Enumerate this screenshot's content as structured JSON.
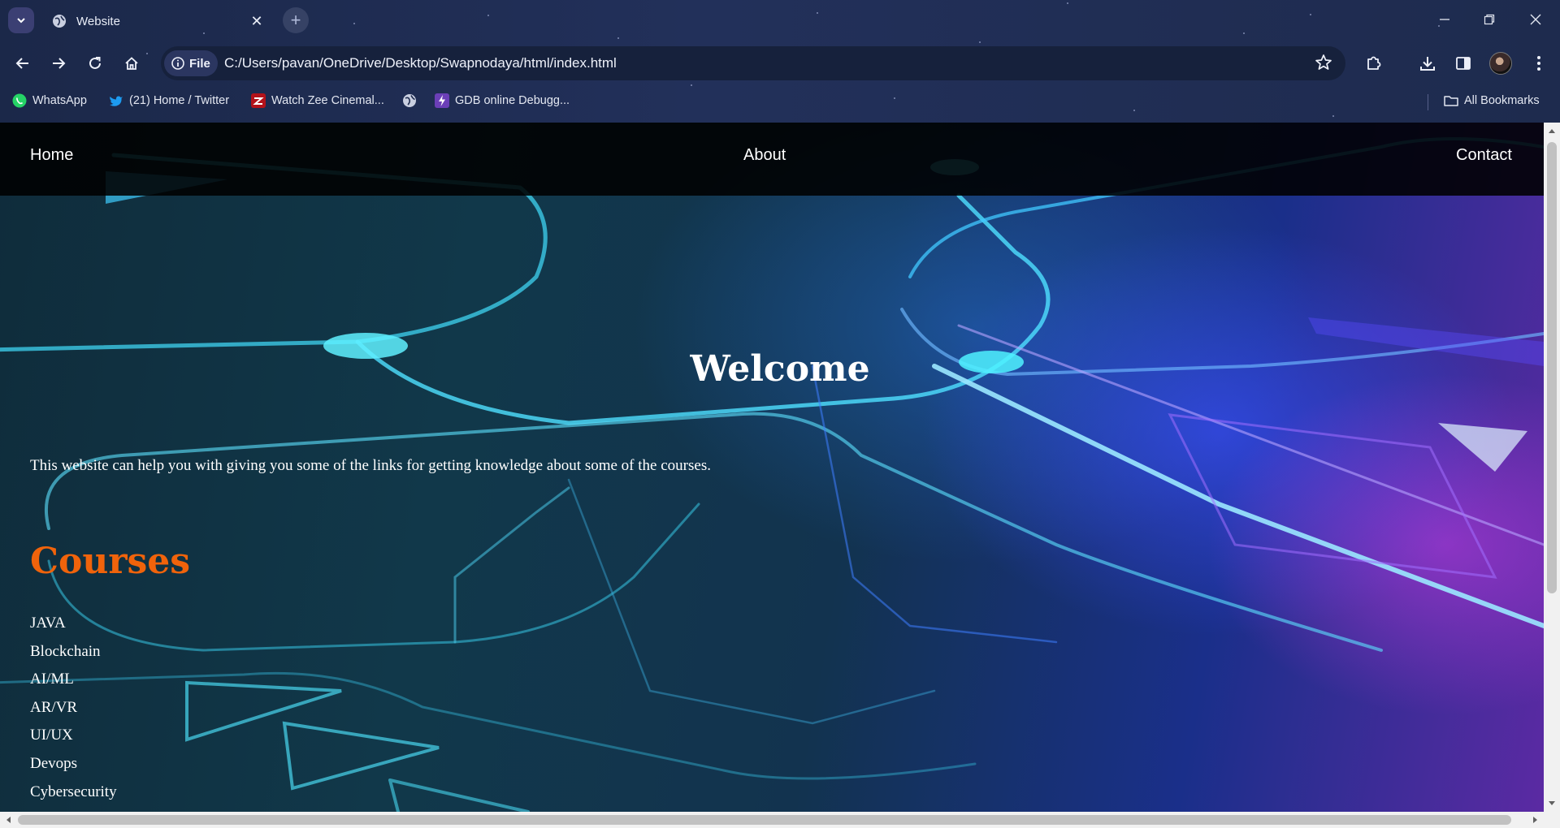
{
  "browser": {
    "tab_title": "Website",
    "new_tab_symbol": "+",
    "close_symbol": "✕",
    "site_info_label": "File",
    "url": "C:/Users/pavan/OneDrive/Desktop/Swapnodaya/html/index.html",
    "bookmarks": [
      {
        "label": "WhatsApp",
        "icon": "whatsapp-icon"
      },
      {
        "label": "(21) Home / Twitter",
        "icon": "twitter-icon"
      },
      {
        "label": "Watch Zee Cinemal...",
        "icon": "zee-icon"
      },
      {
        "label": "",
        "icon": "globe-icon"
      },
      {
        "label": "GDB online Debugg...",
        "icon": "gdb-icon"
      }
    ],
    "all_bookmarks_label": "All Bookmarks"
  },
  "page": {
    "nav": {
      "home": "Home",
      "about": "About",
      "contact": "Contact"
    },
    "welcome_heading": "Welcome",
    "intro_text": "This website can help you with giving you some of the links for getting knowledge about some of the courses.",
    "courses_heading": "Courses",
    "courses": [
      "JAVA",
      "Blockchain",
      "AI/ML",
      "AR/VR",
      "UI/UX",
      "Devops",
      "Cybersecurity"
    ]
  },
  "colors": {
    "courses_heading": "#f0630b",
    "nav_bar": "#000000",
    "chrome_bg": "#1f2a48"
  }
}
